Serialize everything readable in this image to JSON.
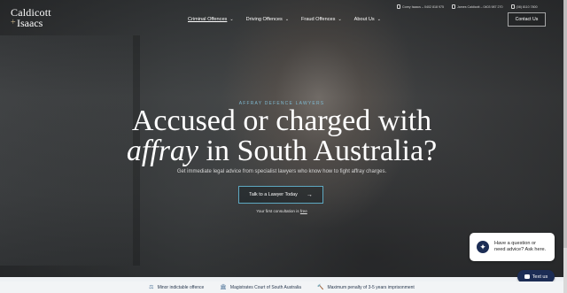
{
  "logo": {
    "line1": "Caldicott",
    "line2": "Isaacs",
    "mark": "+"
  },
  "nav": {
    "items": [
      {
        "label": "Criminal Offences"
      },
      {
        "label": "Driving Offences"
      },
      {
        "label": "Fraud Offences"
      },
      {
        "label": "About Us"
      }
    ]
  },
  "contacts": [
    {
      "text": "Corey Isaacs – 0402 818 975",
      "icon": "phone-icon"
    },
    {
      "text": "James Caldicott – 0403 987 270",
      "icon": "phone-icon"
    },
    {
      "text": "(08) 8110 7800",
      "icon": "phone-icon"
    }
  ],
  "header": {
    "contact_button": "Contact Us"
  },
  "hero": {
    "eyebrow": "AFFRAY DEFENCE LAWYERS",
    "title_line1": "Accused or charged with",
    "title_em": "affray",
    "title_line2_rest": " in South Australia?",
    "subtitle": "Get immediate legal advice from specialist lawyers who know how to fight affray charges.",
    "cta_label": "Talk to a Lawyer Today",
    "note_prefix": "Your first consultation is ",
    "note_link": "free"
  },
  "chat": {
    "line1": "Have a question or",
    "line2": "need advice? Ask here.",
    "button": "Text us"
  },
  "features": [
    {
      "label": "Minor indictable offence",
      "icon": "scales-icon"
    },
    {
      "label": "Magistrates Court of South Australia",
      "icon": "courthouse-icon"
    },
    {
      "label": "Maximum penalty of 3-5 years imprisonment",
      "icon": "gavel-icon"
    }
  ],
  "colors": {
    "accent": "#5ea9c2",
    "navy": "#1c2d55",
    "eyebrow": "#7fb8cf"
  }
}
